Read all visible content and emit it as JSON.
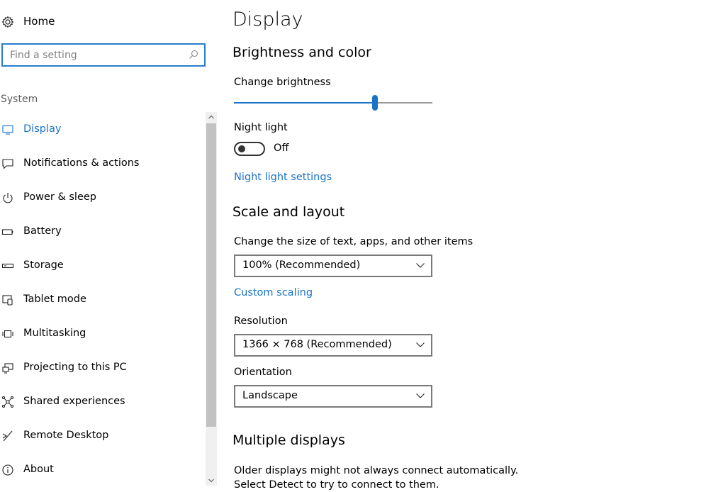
{
  "sidebar": {
    "home_label": "Home",
    "search": {
      "placeholder": "Find a setting",
      "value": ""
    },
    "section_label": "System",
    "items": [
      {
        "label": "Display",
        "icon": "monitor-icon",
        "active": true
      },
      {
        "label": "Notifications & actions",
        "icon": "chat-bubble-icon",
        "active": false
      },
      {
        "label": "Power & sleep",
        "icon": "power-icon",
        "active": false
      },
      {
        "label": "Battery",
        "icon": "battery-icon",
        "active": false
      },
      {
        "label": "Storage",
        "icon": "storage-drive-icon",
        "active": false
      },
      {
        "label": "Tablet mode",
        "icon": "tablet-mode-icon",
        "active": false
      },
      {
        "label": "Multitasking",
        "icon": "multitasking-icon",
        "active": false
      },
      {
        "label": "Projecting to this PC",
        "icon": "projecting-icon",
        "active": false
      },
      {
        "label": "Shared experiences",
        "icon": "shared-experiences-icon",
        "active": false
      },
      {
        "label": "Remote Desktop",
        "icon": "remote-desktop-icon",
        "active": false
      },
      {
        "label": "About",
        "icon": "info-icon",
        "active": false
      }
    ]
  },
  "main": {
    "title": "Display",
    "brightness_section": {
      "heading": "Brightness and color",
      "brightness_label": "Change brightness",
      "brightness_value": 0.71,
      "night_light_label": "Night light",
      "night_light_state": "Off",
      "night_light_settings_link": "Night light settings"
    },
    "scale_section": {
      "heading": "Scale and layout",
      "size_label": "Change the size of text, apps, and other items",
      "size_value": "100% (Recommended)",
      "custom_scaling_link": "Custom scaling",
      "resolution_label": "Resolution",
      "resolution_value": "1366 × 768 (Recommended)",
      "orientation_label": "Orientation",
      "orientation_value": "Landscape"
    },
    "multiple_displays": {
      "heading": "Multiple displays",
      "text": "Older displays might not always connect automatically. Select Detect to try to connect to them."
    }
  },
  "colors": {
    "accent": "#1a73c6",
    "search_border": "#2b7fc9"
  }
}
